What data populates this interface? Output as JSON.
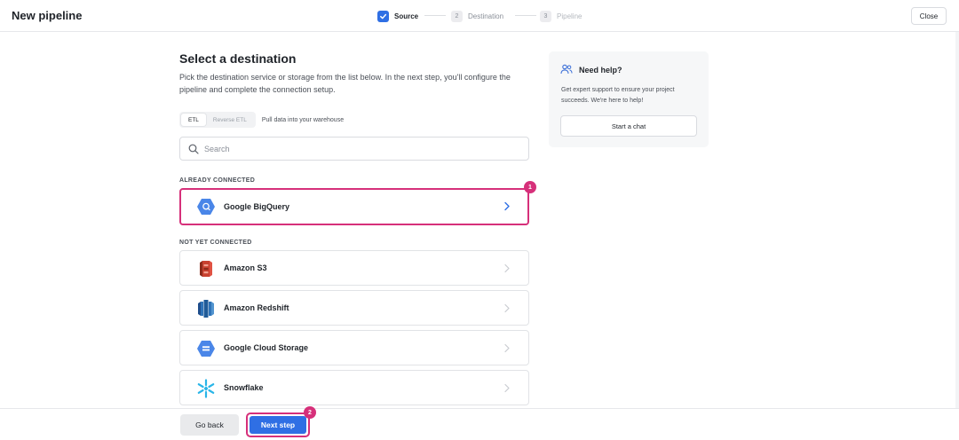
{
  "header": {
    "title": "New pipeline",
    "steps": [
      {
        "number": "",
        "label": "Source",
        "state": "done"
      },
      {
        "number": "2",
        "label": "Destination",
        "state": "pending"
      },
      {
        "number": "3",
        "label": "Pipeline",
        "state": "pending"
      }
    ],
    "close_label": "Close"
  },
  "main": {
    "title": "Select a destination",
    "description": "Pick the destination service or storage from the list below. In the next step, you'll configure the pipeline and complete the connection setup.",
    "toggle": {
      "options": [
        "ETL",
        "Reverse ETL"
      ],
      "selected": "ETL",
      "hint": "Pull data into your warehouse"
    },
    "search": {
      "placeholder": "Search",
      "value": ""
    },
    "connected_label": "ALREADY CONNECTED",
    "connected": [
      {
        "name": "Google BigQuery",
        "icon": "bigquery-logo-icon"
      }
    ],
    "not_connected_label": "NOT YET CONNECTED",
    "not_connected": [
      {
        "name": "Amazon S3",
        "icon": "amazon-s3-logo-icon"
      },
      {
        "name": "Amazon Redshift",
        "icon": "amazon-redshift-logo-icon"
      },
      {
        "name": "Google Cloud Storage",
        "icon": "google-cloud-storage-logo-icon"
      },
      {
        "name": "Snowflake",
        "icon": "snowflake-logo-icon"
      }
    ]
  },
  "help": {
    "title": "Need help?",
    "text": "Get expert support to ensure your project succeeds. We're here to help!",
    "button_label": "Start a chat"
  },
  "footer": {
    "back_label": "Go back",
    "next_label": "Next step"
  },
  "annotations": {
    "badge_1": "1",
    "badge_2": "2"
  },
  "colors": {
    "accent": "#2f6fe4",
    "highlight": "#d6307a"
  }
}
